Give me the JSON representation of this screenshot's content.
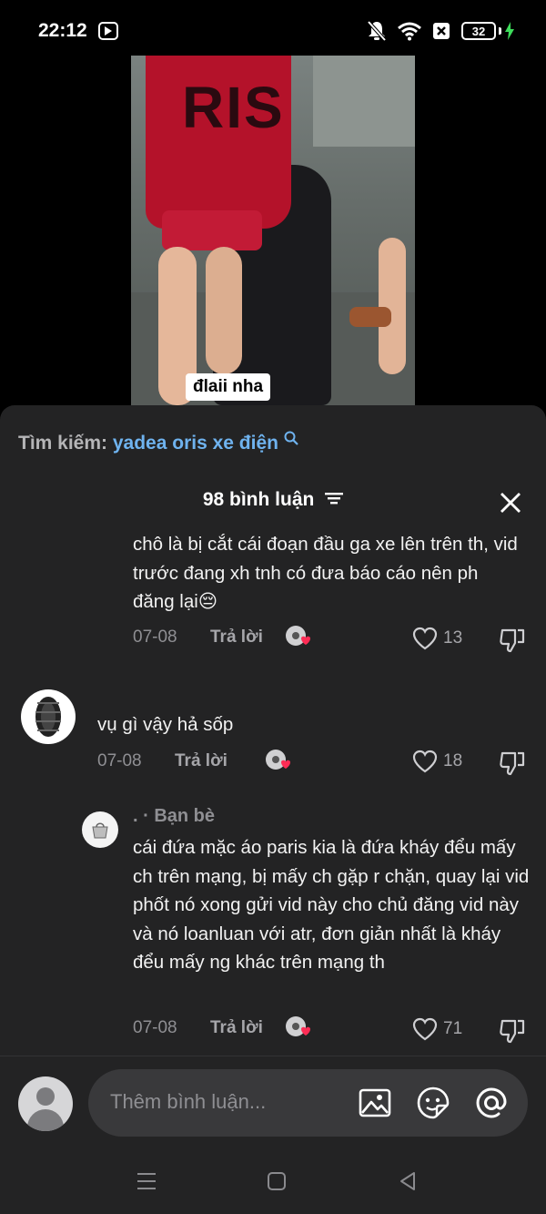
{
  "status_bar": {
    "time": "22:12",
    "battery": "32"
  },
  "video": {
    "caption": "đlaii nha",
    "shirt_print": "RIS"
  },
  "search": {
    "label": "Tìm kiếm:",
    "query": "yadea oris xe điện"
  },
  "header": {
    "title": "98 bình luận"
  },
  "comments": [
    {
      "text": "chô là bị cắt cái đoạn đầu ga xe lên trên th, vid trước đang xh tnh có đưa báo cáo nên ph đăng lại😔",
      "date": "07-08",
      "reply": "Trả lời",
      "likes": "13"
    },
    {
      "text": "vụ gì vậy hả sốp",
      "date": "07-08",
      "reply": "Trả lời",
      "likes": "18"
    },
    {
      "label": ". · Bạn bè",
      "text": "cái đứa mặc áo paris kia là đứa kháy đểu mấy ch trên mạng, bị mấy ch gặp r chặn, quay lại vid phốt nó xong gửi vid này cho chủ đăng vid này và nó loanluan với atr, đơn giản nhất là kháy đểu mấy ng khác trên mạng th",
      "date": "07-08",
      "reply": "Trả lời",
      "likes": "71"
    }
  ],
  "composer": {
    "placeholder": "Thêm bình luận..."
  },
  "colors": {
    "sheet_bg": "#232324",
    "link_blue": "#6fb3ef",
    "reaction_red": "#fe2c55"
  }
}
